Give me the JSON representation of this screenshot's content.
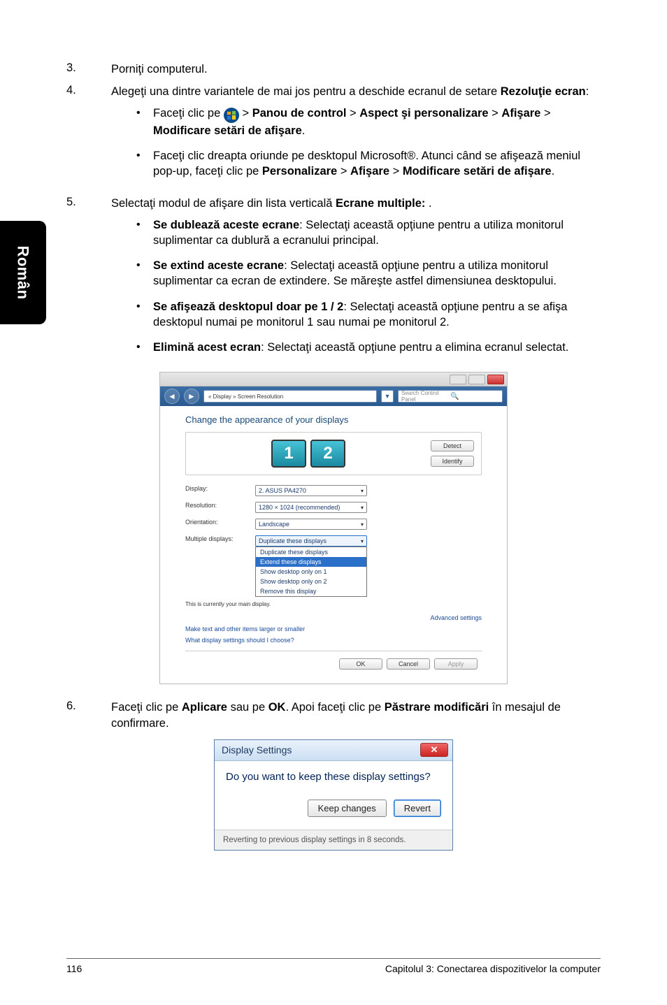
{
  "side_tab": "Român",
  "steps": {
    "s3": {
      "num": "3.",
      "text": "Porniţi computerul."
    },
    "s4": {
      "num": "4.",
      "intro_a": "Alegeţi una dintre variantele de mai jos pentru a deschide ecranul de setare ",
      "intro_b": "Rezoluţie ecran",
      "intro_c": ":",
      "bul1_a": "Faceţi clic pe ",
      "bul1_b": " > ",
      "bul1_c": "Panou de control",
      "bul1_d": " > ",
      "bul1_e": "Aspect şi personalizare",
      "bul1_f": " > ",
      "bul1_g": "Afişare",
      "bul1_h": " > ",
      "bul1_i": "Modificare setări de afişare",
      "bul1_j": ".",
      "bul2_a": "Faceţi clic dreapta oriunde pe desktopul Microsoft®. Atunci când se afişează meniul pop-up, faceţi clic pe ",
      "bul2_b": "Personalizare",
      "bul2_c": " > ",
      "bul2_d": "Afişare",
      "bul2_e": " > ",
      "bul2_f": "Modificare setări de afişare",
      "bul2_g": "."
    },
    "s5": {
      "num": "5.",
      "intro_a": "Selectaţi modul de afişare din lista verticală ",
      "intro_b": "Ecrane multiple: ",
      "intro_c": ".",
      "b1_a": "Se dublează aceste ecrane",
      "b1_b": ": Selectaţi această opţiune pentru a utiliza monitorul suplimentar ca dublură a ecranului principal.",
      "b2_a": "Se extind aceste ecrane",
      "b2_b": ": Selectaţi această opţiune pentru a utiliza monitorul suplimentar ca ecran de extindere. Se măreşte astfel dimensiunea desktopului.",
      "b3_a": "Se afişează desktopul doar pe 1 / 2",
      "b3_b": ": Selectaţi această opţiune pentru a se afişa desktopul numai pe monitorul 1 sau numai pe monitorul 2.",
      "b4_a": "Elimină acest ecran",
      "b4_b": ": Selectaţi această opţiune pentru a elimina ecranul selectat."
    },
    "s6": {
      "num": "6.",
      "a": "Faceţi clic pe ",
      "b": "Aplicare",
      "c": " sau pe ",
      "d": "OK",
      "e": ". Apoi faceţi clic pe ",
      "f": "Păstrare modificări",
      "g": " în mesajul de confirmare."
    }
  },
  "shot1": {
    "crumb": "« Display » Screen Resolution",
    "search_placeholder": "Search Control Panel",
    "heading": "Change the appearance of your displays",
    "mon1": "1",
    "mon2": "2",
    "btn_detect": "Detect",
    "btn_identify": "Identify",
    "labels": {
      "display": "Display:",
      "resolution": "Resolution:",
      "orientation": "Orientation:",
      "multiple": "Multiple displays:"
    },
    "values": {
      "display": "2. ASUS PA4270",
      "resolution": "1280 × 1024 (recommended)",
      "orientation": "Landscape",
      "multiple": "Duplicate these displays"
    },
    "dropdown": {
      "opt1": "Duplicate these displays",
      "opt2": "Extend these displays",
      "opt3": "Show desktop only on 1",
      "opt4": "Show desktop only on 2",
      "opt5": "Remove this display"
    },
    "currently": "This is currently your main display.",
    "advanced": "Advanced settings",
    "link1": "Make text and other items larger or smaller",
    "link2": "What display settings should I choose?",
    "ok": "OK",
    "cancel": "Cancel",
    "apply": "Apply"
  },
  "shot2": {
    "title": "Display Settings",
    "question": "Do you want to keep these display settings?",
    "keep": "Keep changes",
    "revert": "Revert",
    "footer": "Reverting to previous display settings in 8 seconds."
  },
  "footer": {
    "page": "116",
    "chapter": "Capitolul 3: Conectarea dispozitivelor la computer"
  }
}
